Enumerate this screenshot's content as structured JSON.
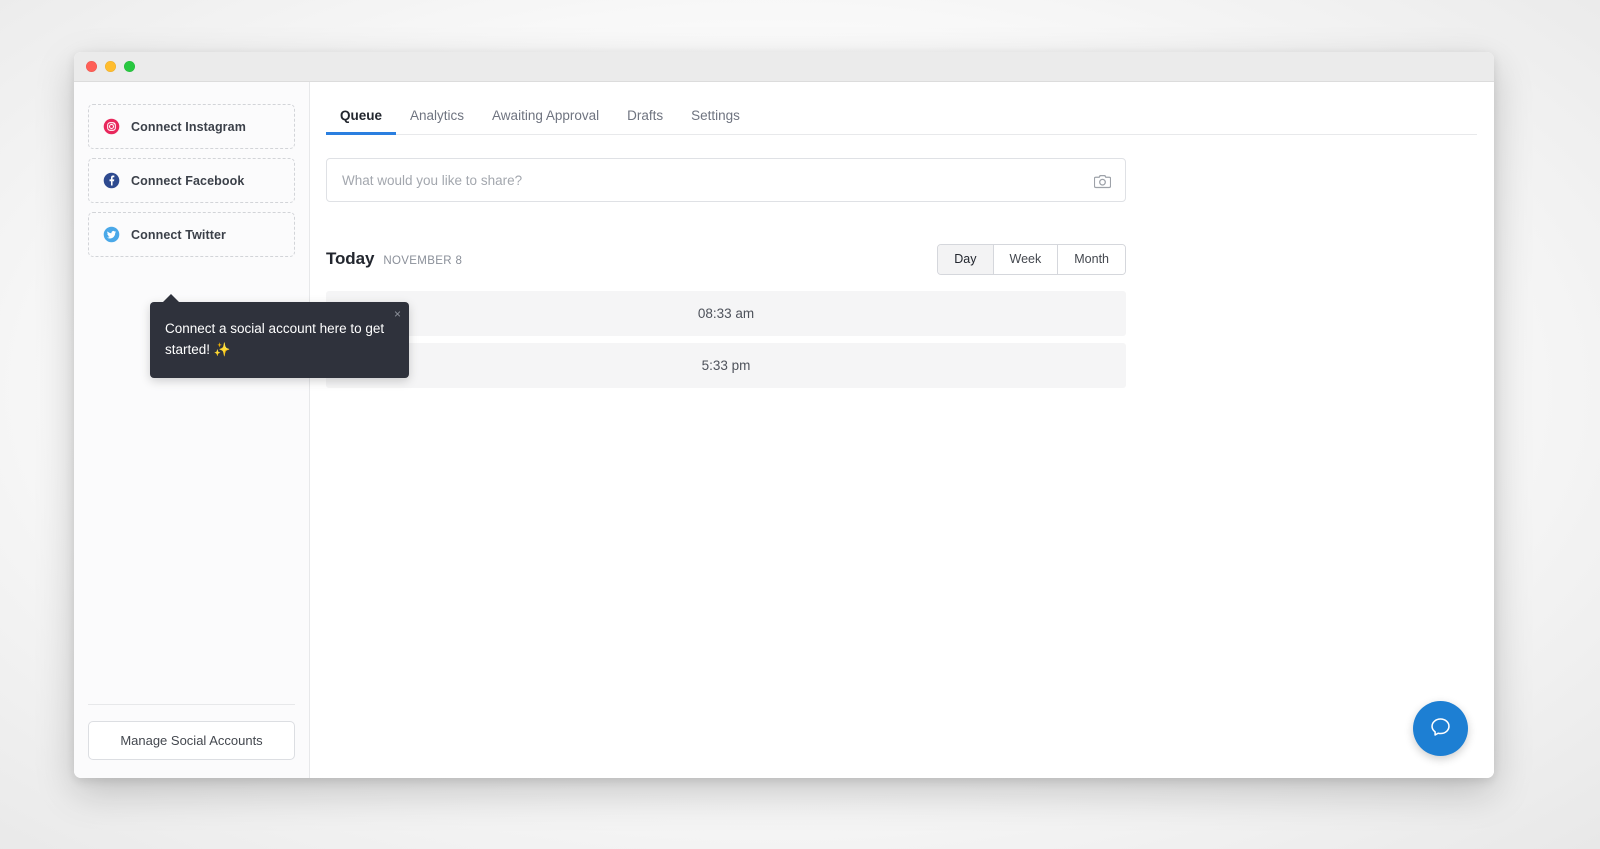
{
  "window": {
    "traffic_lights": [
      {
        "name": "close",
        "color": "#ff5f57"
      },
      {
        "name": "minimize",
        "color": "#ffbd2e"
      },
      {
        "name": "maximize",
        "color": "#28c840"
      }
    ]
  },
  "sidebar": {
    "connect_accounts": [
      {
        "label": "Connect Instagram",
        "icon": "instagram-icon",
        "color": "#e8275c"
      },
      {
        "label": "Connect Facebook",
        "icon": "facebook-icon",
        "color": "#2e4a8f"
      },
      {
        "label": "Connect Twitter",
        "icon": "twitter-icon",
        "color": "#4aa8e8"
      }
    ],
    "manage_button_label": "Manage Social Accounts"
  },
  "tabs": [
    {
      "label": "Queue",
      "active": true
    },
    {
      "label": "Analytics",
      "active": false
    },
    {
      "label": "Awaiting Approval",
      "active": false
    },
    {
      "label": "Drafts",
      "active": false
    },
    {
      "label": "Settings",
      "active": false
    }
  ],
  "composer": {
    "placeholder": "What would you like to share?",
    "value": "",
    "attach_icon": "camera-icon"
  },
  "schedule": {
    "today_label": "Today",
    "date_label": "NOVEMBER 8",
    "range_options": [
      {
        "label": "Day",
        "active": true
      },
      {
        "label": "Week",
        "active": false
      },
      {
        "label": "Month",
        "active": false
      }
    ],
    "slots": [
      {
        "time": "08:33 am"
      },
      {
        "time": "5:33 pm"
      }
    ]
  },
  "tooltip": {
    "text": "Connect a social account here to get started! ✨",
    "close_label": "×"
  },
  "help": {
    "icon": "chat-bubble-icon",
    "color": "#1d7fd3"
  },
  "theme": {
    "accent": "#2a7fe0",
    "tooltip_bg": "#2f323c",
    "slot_bg": "#f5f5f6"
  }
}
